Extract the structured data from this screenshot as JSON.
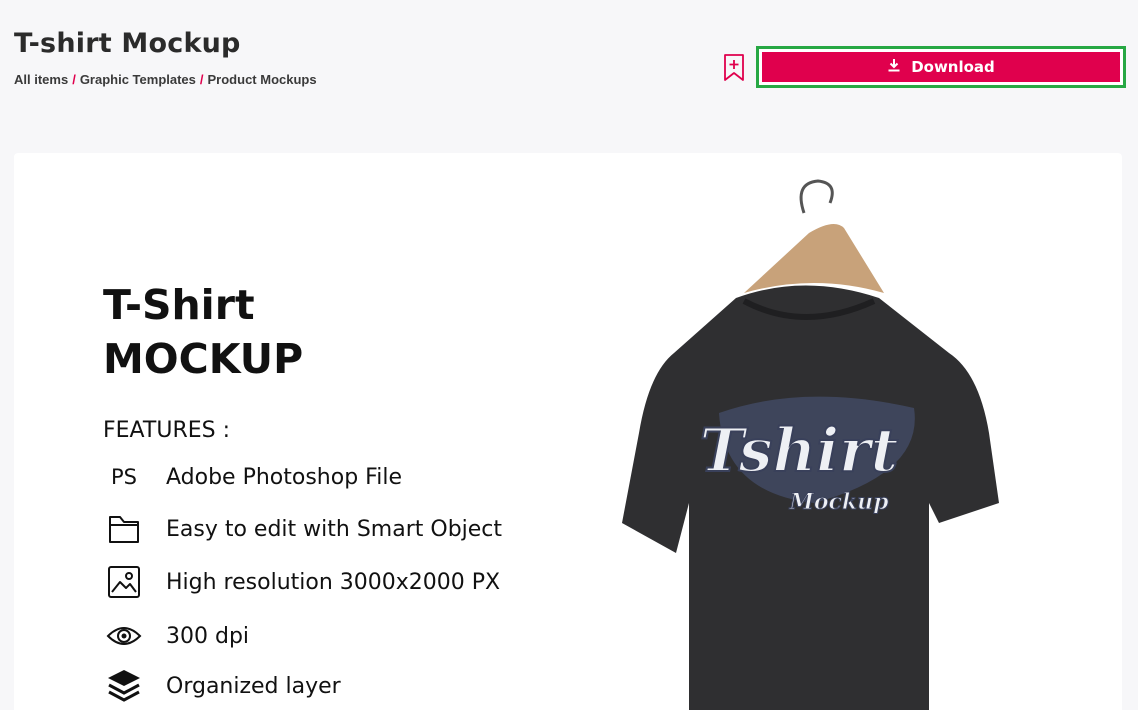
{
  "header": {
    "title": "T-shirt Mockup",
    "breadcrumb": [
      {
        "label": "All items"
      },
      {
        "label": "Graphic Templates"
      },
      {
        "label": "Product Mockups"
      }
    ],
    "separator": "/",
    "bookmark_icon": "bookmark-add-icon",
    "download_label": "Download",
    "download_icon": "download-icon",
    "accent_color": "#e0004d",
    "highlight_color": "#27a844"
  },
  "preview": {
    "heading_line1": "T-Shirt",
    "heading_line2": "MOCKUP",
    "features_label": "FEATURES :",
    "features": [
      {
        "icon": "ps-icon",
        "glyph": "PS",
        "text": "Adobe Photoshop File"
      },
      {
        "icon": "folder-icon",
        "text": "Easy to edit with Smart Object"
      },
      {
        "icon": "image-icon",
        "text": "High resolution 3000x2000 PX"
      },
      {
        "icon": "eye-icon",
        "text": "300 dpi"
      },
      {
        "icon": "layers-icon",
        "text": "Organized layer"
      }
    ],
    "shirt_logo_main": "Tshirt",
    "shirt_logo_sub": "Mockup"
  }
}
